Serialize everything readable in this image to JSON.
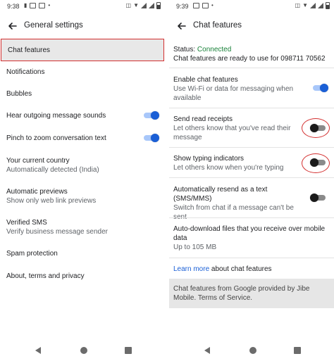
{
  "left": {
    "status": {
      "time": "9:38"
    },
    "title": "General settings",
    "items": [
      {
        "title": "Chat features"
      },
      {
        "title": "Notifications"
      },
      {
        "title": "Bubbles"
      },
      {
        "title": "Hear outgoing message sounds",
        "toggle": "on"
      },
      {
        "title": "Pinch to zoom conversation text",
        "toggle": "on"
      },
      {
        "title": "Your current country",
        "sub": "Automatically detected (India)"
      },
      {
        "title": "Automatic previews",
        "sub": "Show only web link previews"
      },
      {
        "title": "Verified SMS",
        "sub": "Verify business message sender"
      },
      {
        "title": "Spam protection"
      },
      {
        "title": "About, terms and privacy"
      }
    ]
  },
  "right": {
    "status": {
      "time": "9:39"
    },
    "title": "Chat features",
    "status_row": {
      "label": "Status: ",
      "value": "Connected",
      "sub": "Chat features are ready to use for 098711 70562"
    },
    "items": [
      {
        "title": "Enable chat features",
        "sub": "Use Wi-Fi or data for messaging when available",
        "toggle": "on"
      },
      {
        "title": "Send read receipts",
        "sub": "Let others know that you've read their message",
        "toggle": "off"
      },
      {
        "title": "Show typing indicators",
        "sub": "Let others know when you're typing",
        "toggle": "off"
      },
      {
        "title": "Automatically resend as a text (SMS/MMS)",
        "sub": "Switch from chat if a message can't be sent",
        "toggle": "off"
      },
      {
        "title": "Auto-download files that you receive over mobile data",
        "sub": "Up to 105 MB"
      }
    ],
    "learn_more": {
      "link": "Learn more",
      "rest": " about chat features"
    },
    "footer": "Chat features from Google provided by Jibe Mobile. Terms of Service."
  },
  "colors": {
    "accent": "#1a5fd6",
    "connected": "#188038",
    "highlight": "#d32f2f",
    "selected_bg": "#e8e8e8"
  },
  "icons": [
    "back-arrow-icon",
    "wifi-icon",
    "battery-icon",
    "signal-icon",
    "nav-back-icon",
    "nav-home-icon",
    "nav-recents-icon"
  ]
}
